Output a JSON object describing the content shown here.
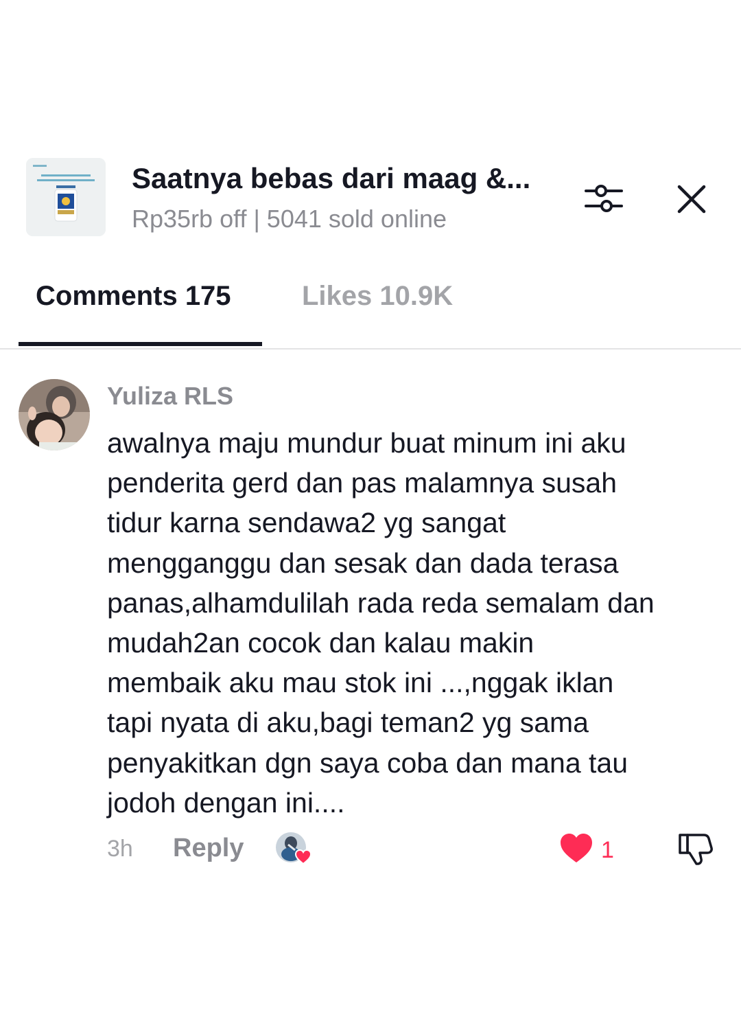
{
  "product": {
    "title": "Saatnya bebas dari maag &...",
    "subtitle": "Rp35rb off | 5041 sold online",
    "thumbnail_icon": "product-package-image"
  },
  "header_icons": {
    "filter": "sliders-icon",
    "close": "close-x-icon"
  },
  "tabs": [
    {
      "label": "Comments 175",
      "active": true
    },
    {
      "label": "Likes 10.9K",
      "active": false
    }
  ],
  "comment": {
    "username": "Yuliza RLS",
    "text": "awalnya maju mundur buat minum ini aku\npenderita gerd dan pas malamnya susah\ntidur karna sendawa2 yg sangat\nmengganggu dan sesak dan dada terasa\npanas,alhamdulilah rada reda semalam dan\nmudah2an cocok dan kalau makin\nmembaik aku mau stok ini ...,nggak iklan\ntapi nyata di aku,bagi teman2 yg sama\npenyakitkan dgn saya coba dan mana tau\njodoh dengan ini....",
    "time": "3h",
    "reply_label": "Reply",
    "like_count": "1",
    "liked": true
  },
  "colors": {
    "accent": "#fe2c55",
    "text_primary": "#161823",
    "text_secondary": "#8a8b91",
    "divider": "#e3e3e4"
  }
}
